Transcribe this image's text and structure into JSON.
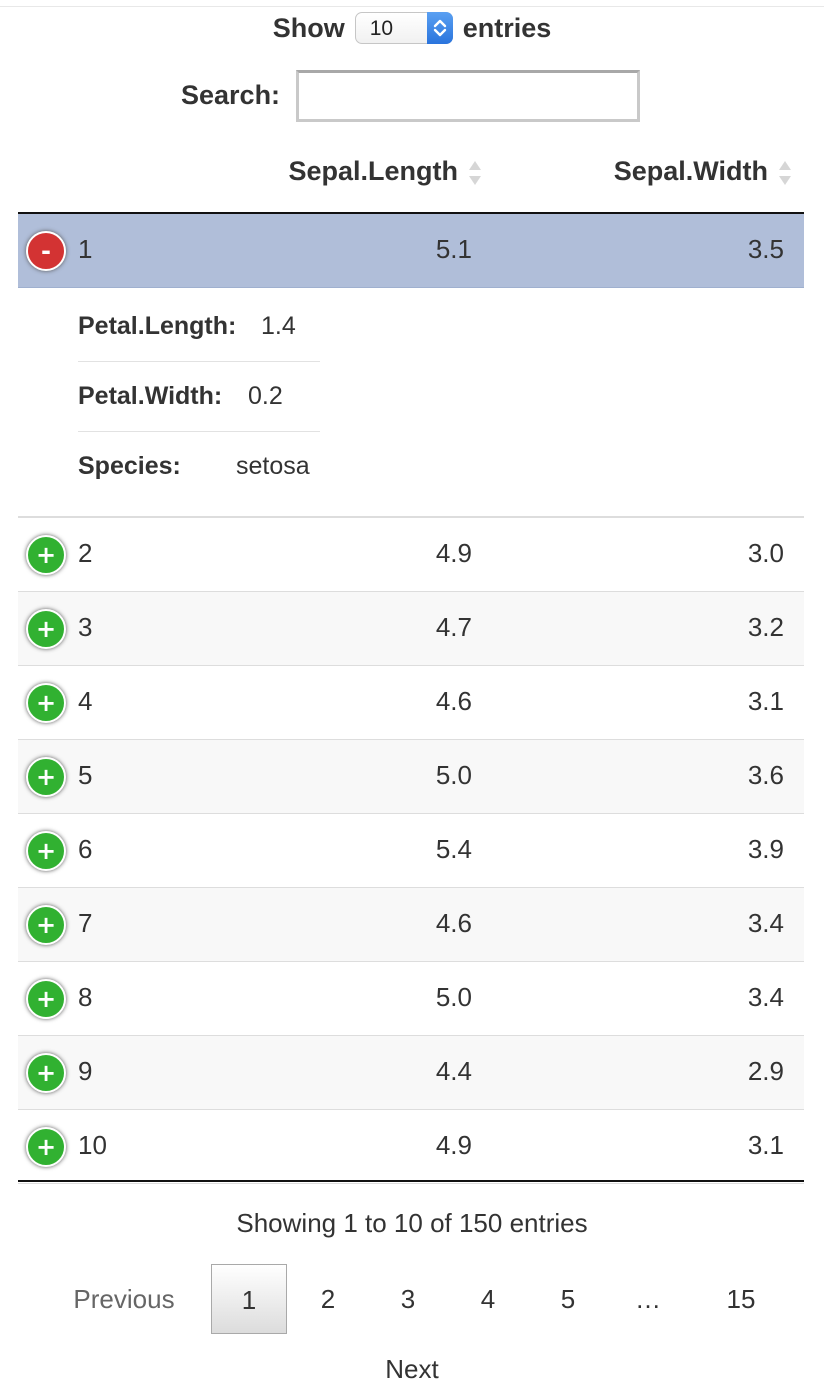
{
  "length_control": {
    "prefix": "Show",
    "selected": "10",
    "suffix": "entries"
  },
  "search": {
    "label": "Search:",
    "value": "",
    "placeholder": ""
  },
  "table": {
    "columns": [
      "",
      "Sepal.Length",
      "Sepal.Width"
    ],
    "expanded_row": {
      "id": "1",
      "sepal_length": "5.1",
      "sepal_width": "3.5",
      "toggle": "-",
      "details": [
        {
          "key": "Petal.Length:",
          "value": "1.4"
        },
        {
          "key": "Petal.Width:",
          "value": "0.2"
        },
        {
          "key": "Species:",
          "value": "setosa"
        }
      ]
    },
    "rows": [
      {
        "id": "2",
        "sepal_length": "4.9",
        "sepal_width": "3.0",
        "toggle": "+"
      },
      {
        "id": "3",
        "sepal_length": "4.7",
        "sepal_width": "3.2",
        "toggle": "+"
      },
      {
        "id": "4",
        "sepal_length": "4.6",
        "sepal_width": "3.1",
        "toggle": "+"
      },
      {
        "id": "5",
        "sepal_length": "5.0",
        "sepal_width": "3.6",
        "toggle": "+"
      },
      {
        "id": "6",
        "sepal_length": "5.4",
        "sepal_width": "3.9",
        "toggle": "+"
      },
      {
        "id": "7",
        "sepal_length": "4.6",
        "sepal_width": "3.4",
        "toggle": "+"
      },
      {
        "id": "8",
        "sepal_length": "5.0",
        "sepal_width": "3.4",
        "toggle": "+"
      },
      {
        "id": "9",
        "sepal_length": "4.4",
        "sepal_width": "2.9",
        "toggle": "+"
      },
      {
        "id": "10",
        "sepal_length": "4.9",
        "sepal_width": "3.1",
        "toggle": "+"
      }
    ]
  },
  "info": "Showing 1 to 10 of 150 entries",
  "pagination": {
    "previous": "Previous",
    "pages": [
      "1",
      "2",
      "3",
      "4",
      "5",
      "…",
      "15"
    ],
    "current": "1",
    "next": "Next"
  },
  "colors": {
    "selected_row": "#b0bed9",
    "expand_button": "#31b131",
    "collapse_button": "#d33333",
    "select_arrow": "#2a74dd"
  },
  "icons": {
    "select_arrows": "updown-chevron-icon",
    "sort": "sort-both-icon",
    "expand": "plus-circle-icon",
    "collapse": "minus-circle-icon"
  }
}
